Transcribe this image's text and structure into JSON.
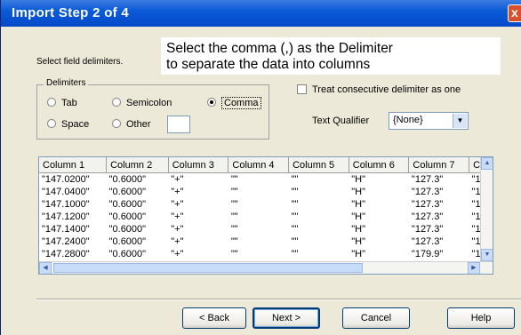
{
  "window": {
    "title": "Import Step 2 of 4",
    "close_glyph": "x"
  },
  "instruction": {
    "line1": "Select the comma (,) as the Delimiter",
    "line2": "to separate the data into columns"
  },
  "select_label": "Select field delimiters.",
  "delimiters": {
    "title": "Delimiters",
    "options": [
      {
        "label": "Tab",
        "selected": false
      },
      {
        "label": "Semicolon",
        "selected": false
      },
      {
        "label": "Comma",
        "selected": true
      },
      {
        "label": "Space",
        "selected": false
      },
      {
        "label": "Other",
        "selected": false
      }
    ],
    "other_value": ""
  },
  "treat_consecutive": {
    "label": "Treat consecutive delimiter as one",
    "checked": false
  },
  "text_qualifier": {
    "label": "Text Qualifier",
    "value": "{None}"
  },
  "grid": {
    "columns": [
      "Column 1",
      "Column 2",
      "Column 3",
      "Column 4",
      "Column 5",
      "Column 6",
      "Column 7",
      "Co"
    ],
    "rows": [
      [
        "\"147.0200\"",
        "\"0.6000\"",
        "\"+\"",
        "\"\"",
        "\"\"",
        "\"H\"",
        "\"127.3\"",
        "\"1."
      ],
      [
        "\"147.0400\"",
        "\"0.6000\"",
        "\"+\"",
        "\"\"",
        "\"\"",
        "\"H\"",
        "\"127.3\"",
        "\"1."
      ],
      [
        "\"147.1000\"",
        "\"0.6000\"",
        "\"+\"",
        "\"\"",
        "\"\"",
        "\"H\"",
        "\"127.3\"",
        "\"1."
      ],
      [
        "\"147.1200\"",
        "\"0.6000\"",
        "\"+\"",
        "\"\"",
        "\"\"",
        "\"H\"",
        "\"127.3\"",
        "\"1."
      ],
      [
        "\"147.1400\"",
        "\"0.6000\"",
        "\"+\"",
        "\"\"",
        "\"\"",
        "\"H\"",
        "\"127.3\"",
        "\"1."
      ],
      [
        "\"147.2400\"",
        "\"0.6000\"",
        "\"+\"",
        "\"\"",
        "\"\"",
        "\"H\"",
        "\"127.3\"",
        "\"1."
      ],
      [
        "\"147.2800\"",
        "\"0.6000\"",
        "\"+\"",
        "\"\"",
        "\"\"",
        "\"H\"",
        "\"179.9\"",
        "\"1"
      ]
    ]
  },
  "buttons": {
    "back": "< Back",
    "next": "Next >",
    "cancel": "Cancel",
    "help": "Help"
  },
  "colors": {
    "titlebar": "#0a5bd8",
    "dialog": "#ece9d8",
    "close": "#d9502e"
  }
}
